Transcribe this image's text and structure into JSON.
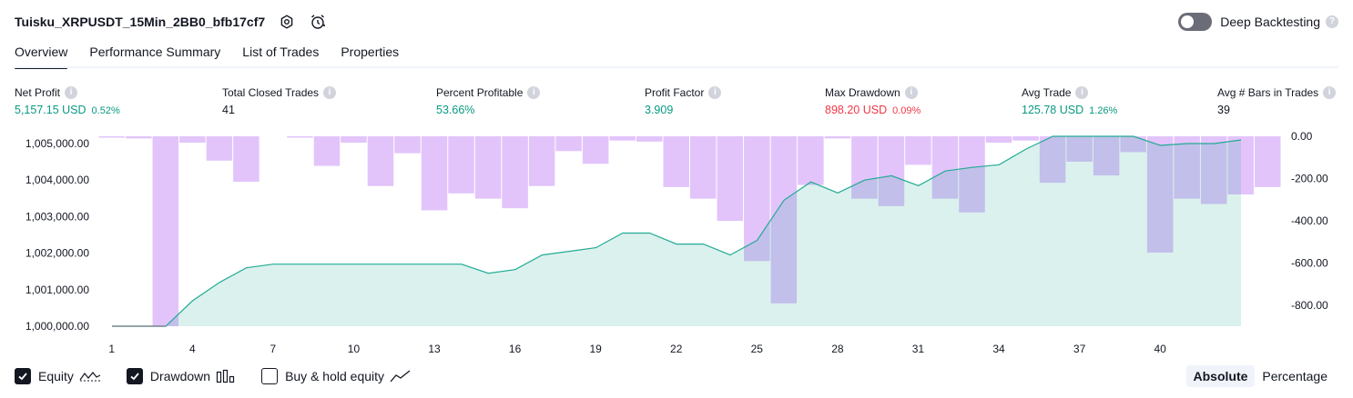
{
  "header": {
    "title": "Tuisku_XRPUSDT_15Min_2BB0_bfb17cf7",
    "settings_icon": "gear-icon",
    "alert_icon": "alarm-clock-icon"
  },
  "deep_backtesting": {
    "label": "Deep Backtesting",
    "enabled": false,
    "help": "?"
  },
  "tabs": [
    {
      "label": "Overview",
      "active": true
    },
    {
      "label": "Performance Summary",
      "active": false
    },
    {
      "label": "List of Trades",
      "active": false
    },
    {
      "label": "Properties",
      "active": false
    }
  ],
  "metrics": [
    {
      "label": "Net Profit",
      "value": "5,157.15 USD",
      "pct": "0.52%",
      "color": "green",
      "help": "i"
    },
    {
      "label": "Total Closed Trades",
      "value": "41",
      "pct": "",
      "color": "dark",
      "help": "i"
    },
    {
      "label": "Percent Profitable",
      "value": "53.66%",
      "pct": "",
      "color": "green",
      "help": "i"
    },
    {
      "label": "Profit Factor",
      "value": "3.909",
      "pct": "",
      "color": "green",
      "help": "i"
    },
    {
      "label": "Max Drawdown",
      "value": "898.20 USD",
      "pct": "0.09%",
      "color": "red",
      "help": "i"
    },
    {
      "label": "Avg Trade",
      "value": "125.78 USD",
      "pct": "1.26%",
      "color": "green",
      "help": "i"
    },
    {
      "label": "Avg # Bars in Trades",
      "value": "39",
      "pct": "",
      "color": "dark",
      "help": "i"
    }
  ],
  "chart_data": {
    "type": "area",
    "x_ticks": [
      1,
      4,
      7,
      10,
      13,
      16,
      19,
      22,
      25,
      28,
      31,
      34,
      37,
      40
    ],
    "left_axis": {
      "ticks": [
        1000000,
        1001000,
        1002000,
        1003000,
        1004000,
        1005000
      ],
      "tick_labels": [
        "1,000,000.00",
        "1,001,000.00",
        "1,002,000.00",
        "1,003,000.00",
        "1,004,000.00",
        "1,005,000.00"
      ],
      "range": [
        1000000,
        1005200
      ]
    },
    "right_axis": {
      "ticks": [
        0,
        -200,
        -400,
        -600,
        -800
      ],
      "tick_labels": [
        "0.00",
        "-200.00",
        "-400.00",
        "-600.00",
        "-800.00"
      ],
      "range": [
        -898.2,
        0
      ]
    },
    "equity": [
      1000000,
      1000000,
      1000000,
      1000700,
      1001200,
      1001600,
      1001700,
      1001700,
      1001700,
      1001700,
      1001700,
      1001700,
      1001700,
      1001700,
      1001450,
      1001550,
      1001950,
      1002050,
      1002150,
      1002550,
      1002550,
      1002250,
      1002250,
      1001950,
      1002350,
      1003450,
      1003950,
      1003650,
      1004000,
      1004120,
      1003850,
      1004250,
      1004350,
      1004420,
      1004850,
      1005200,
      1005200,
      1005200,
      1005200,
      1004950,
      1005000,
      1005000,
      1005100
    ],
    "drawdown": [
      -5,
      -10,
      -898,
      -30,
      -115,
      -215,
      0,
      -5,
      -140,
      -30,
      -235,
      -80,
      -350,
      -270,
      -295,
      -340,
      -235,
      -70,
      -130,
      -20,
      -25,
      -240,
      -295,
      -400,
      -590,
      -790,
      -230,
      -10,
      -295,
      -330,
      -135,
      -295,
      -360,
      -30,
      -20,
      -220,
      -120,
      -185,
      -75,
      -550,
      -295,
      -320,
      -275,
      -240
    ],
    "colors": {
      "equity_line": "#22ab94",
      "equity_fill": "#22ab94",
      "drawdown": "#cf9df9"
    }
  },
  "legend": {
    "items": [
      {
        "label": "Equity",
        "checked": true,
        "icon": "equity-line-icon"
      },
      {
        "label": "Drawdown",
        "checked": true,
        "icon": "bar-chart-icon"
      },
      {
        "label": "Buy & hold equity",
        "checked": false,
        "icon": "trend-line-icon"
      }
    ]
  },
  "modes": [
    {
      "label": "Absolute",
      "active": true
    },
    {
      "label": "Percentage",
      "active": false
    }
  ]
}
